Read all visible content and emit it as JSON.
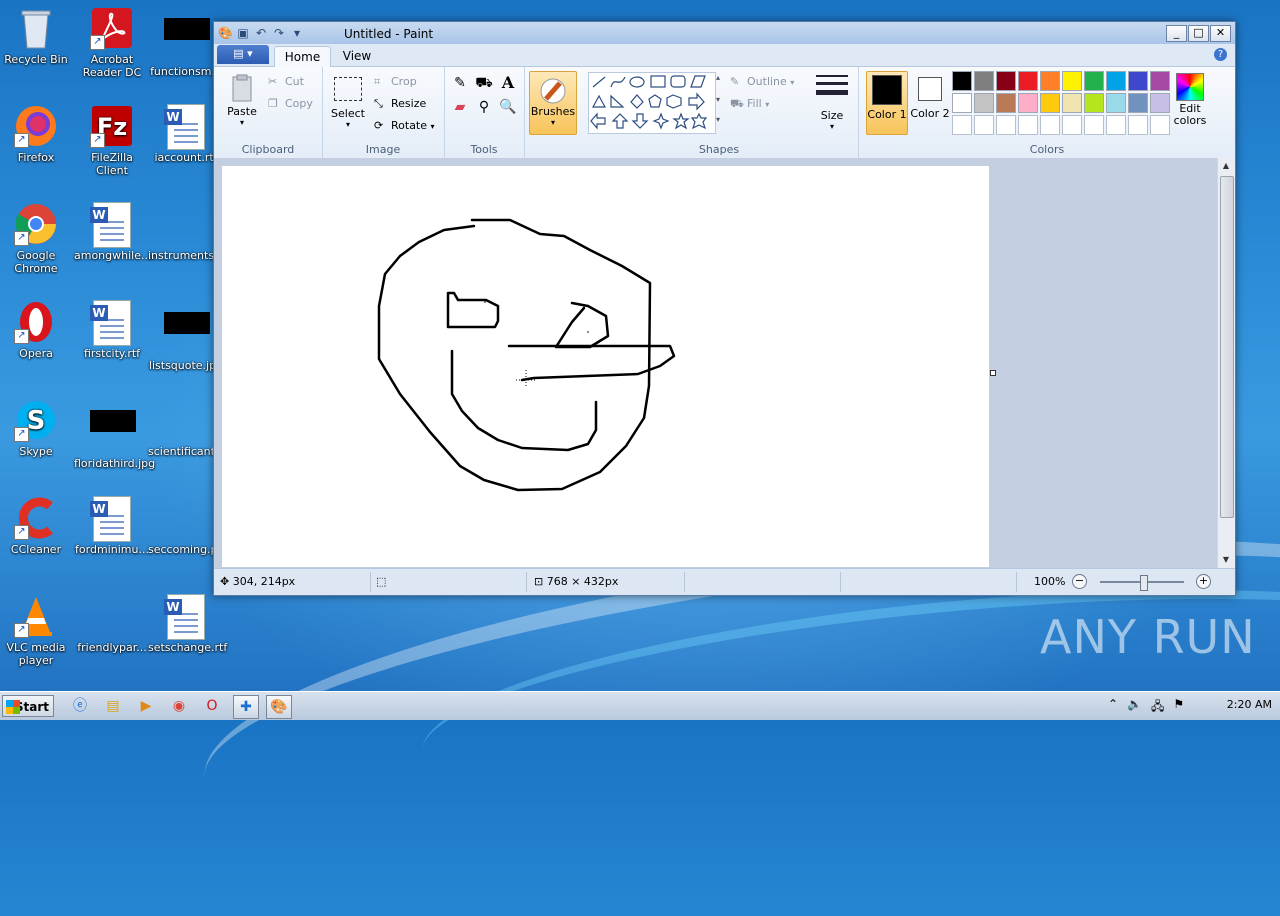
{
  "desktop": {
    "icons": [
      {
        "label": "Recycle Bin"
      },
      {
        "label": "Acrobat Reader DC"
      },
      {
        "label": "functionsm..."
      },
      {
        "label": "Firefox"
      },
      {
        "label": "FileZilla Client"
      },
      {
        "label": "iaccount.rtf"
      },
      {
        "label": "Google Chrome"
      },
      {
        "label": "amongwhile...."
      },
      {
        "label": "instruments...."
      },
      {
        "label": "Opera"
      },
      {
        "label": "firstcity.rtf"
      },
      {
        "label": "listsquote.jpg"
      },
      {
        "label": "Skype"
      },
      {
        "label": "floridathird.jpg"
      },
      {
        "label": "scientificant...."
      },
      {
        "label": "CCleaner"
      },
      {
        "label": "fordminimu..."
      },
      {
        "label": "seccoming.p..."
      },
      {
        "label": "VLC media player"
      },
      {
        "label": "friendlypar..."
      },
      {
        "label": "setschange.rtf"
      }
    ]
  },
  "window": {
    "title": "Untitled - Paint",
    "tabs": {
      "file": "",
      "home": "Home",
      "view": "View"
    },
    "ribbon": {
      "clipboard": {
        "label": "Clipboard",
        "paste": "Paste",
        "cut": "Cut",
        "copy": "Copy"
      },
      "image": {
        "label": "Image",
        "select": "Select",
        "crop": "Crop",
        "resize": "Resize",
        "rotate": "Rotate"
      },
      "tools": {
        "label": "Tools"
      },
      "brushes": {
        "label": "Brushes"
      },
      "shapes": {
        "label": "Shapes",
        "outline": "Outline",
        "fill": "Fill"
      },
      "size": {
        "label": "Size"
      },
      "colors": {
        "label": "Colors",
        "color1": "Color 1",
        "color2": "Color 2",
        "edit": "Edit colors",
        "color1_value": "#000000",
        "color2_value": "#ffffff",
        "palette_row1": [
          "#000000",
          "#7f7f7f",
          "#880015",
          "#ed1c24",
          "#ff7f27",
          "#fff200",
          "#22b14c",
          "#00a2e8",
          "#3f48cc",
          "#a349a4"
        ],
        "palette_row2": [
          "#ffffff",
          "#c3c3c3",
          "#b97a57",
          "#ffaec9",
          "#ffc90e",
          "#efe4b0",
          "#b5e61d",
          "#99d9ea",
          "#7092be",
          "#c8bfe7"
        ]
      }
    },
    "status": {
      "cursor_pos": "304, 214px",
      "canvas_size": "768 × 432px",
      "zoom": "100%"
    }
  },
  "taskbar": {
    "start": "Start",
    "time": "2:20 AM"
  },
  "watermark": "ANY RUN"
}
